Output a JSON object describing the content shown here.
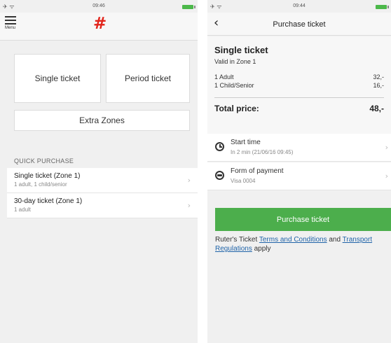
{
  "left": {
    "status": {
      "time": "09:46"
    },
    "menu_label": "Menu",
    "logo": "#",
    "tiles": {
      "single": "Single ticket",
      "period": "Period ticket",
      "extra": "Extra Zones"
    },
    "quick_purchase_title": "QUICK PURCHASE",
    "quick_items": [
      {
        "title": "Single ticket (Zone 1)",
        "sub": "1 adult, 1 child/senior"
      },
      {
        "title": "30-day ticket (Zone 1)",
        "sub": "1 adult"
      }
    ]
  },
  "right": {
    "status": {
      "time": "09:44"
    },
    "nav_title": "Purchase ticket",
    "summary": {
      "title": "Single ticket",
      "zone": "Valid in Zone 1",
      "lines": [
        {
          "label": "1 Adult",
          "value": "32,-"
        },
        {
          "label": "1 Child/Senior",
          "value": "16,-"
        }
      ],
      "total_label": "Total price:",
      "total_value": "48,-"
    },
    "start_time": {
      "label": "Start time",
      "value": "In 2 min (21/06/16 09:45)"
    },
    "payment": {
      "label": "Form of payment",
      "value": "Visa 0004"
    },
    "purchase_button": "Purchase ticket",
    "terms": {
      "prefix": "Ruter's Ticket",
      "link1": "Terms and Conditions",
      "mid": "and",
      "link2": "Transport Regulations",
      "suffix": "apply"
    }
  },
  "colors": {
    "accent_green": "#4cae4c",
    "logo_red": "#e2231a",
    "link_blue": "#1f63a8"
  }
}
